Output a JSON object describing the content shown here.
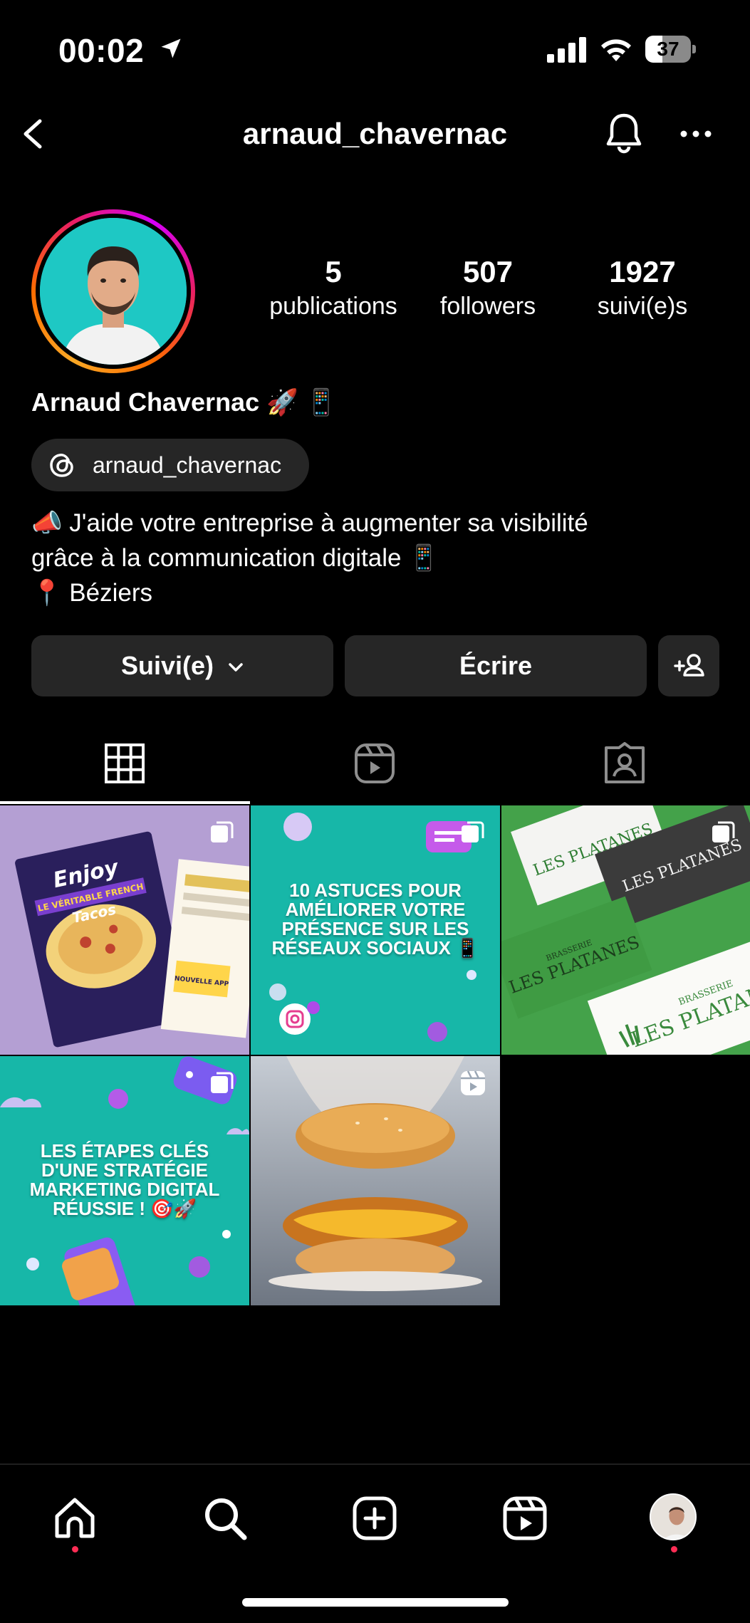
{
  "status_bar": {
    "time": "00:02",
    "battery": "37",
    "battery_level": 0.37,
    "icons": [
      "location-arrow-icon",
      "signal-icon",
      "wifi-icon",
      "battery-icon"
    ]
  },
  "header": {
    "username": "arnaud_chavernac",
    "icons": [
      "back-icon",
      "bell-icon",
      "more-icon"
    ]
  },
  "profile": {
    "stats": {
      "posts_count": "5",
      "posts_label": "publications",
      "followers_count": "507",
      "followers_label": "followers",
      "following_count": "1927",
      "following_label": "suivi(e)s"
    },
    "display_name": "Arnaud Chavernac 🚀 📱",
    "threads_handle": "arnaud_chavernac",
    "bio_lines": [
      "📣 J'aide votre entreprise à augmenter sa visibilité",
      "grâce à la communication digitale 📱",
      "📍 Béziers"
    ]
  },
  "actions": {
    "follow_label": "Suivi(e)",
    "message_label": "Écrire",
    "add_icon": "add-person-icon"
  },
  "tabs": [
    {
      "icon": "grid-icon",
      "active": true
    },
    {
      "icon": "reels-icon",
      "active": false
    },
    {
      "icon": "tagged-icon",
      "active": false
    }
  ],
  "posts": [
    {
      "type": "carousel",
      "lines": [
        "Enjoy",
        "LE VÉRITABLE FRENCH",
        "Tacos",
        "NOUVELLE APP"
      ]
    },
    {
      "type": "carousel",
      "caption": "10 ASTUCES POUR AMÉLIORER VOTRE PRÉSENCE SUR LES RÉSEAUX SOCIAUX 📱"
    },
    {
      "type": "carousel",
      "lines": [
        "BRASSERIE",
        "LES PLATANES"
      ]
    },
    {
      "type": "carousel",
      "caption": "LES ÉTAPES CLÉS D'UNE STRATÉGIE MARKETING DIGITAL RÉUSSIE ! 🎯🚀"
    },
    {
      "type": "reel",
      "caption": ""
    }
  ],
  "bottom_nav": [
    {
      "icon": "home-icon",
      "notification": true
    },
    {
      "icon": "search-icon",
      "notification": false
    },
    {
      "icon": "create-icon",
      "notification": false
    },
    {
      "icon": "reels-icon",
      "notification": false
    },
    {
      "icon": "profile-avatar",
      "notification": true
    }
  ],
  "colors": {
    "background": "#000000",
    "button_bg": "#262626",
    "notification_dot": "#ff2d55"
  }
}
